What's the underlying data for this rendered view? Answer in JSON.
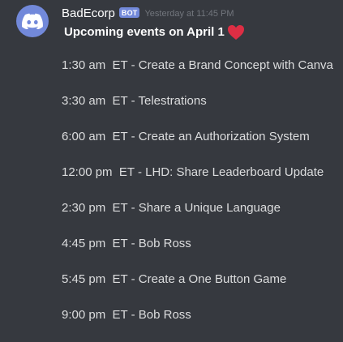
{
  "message": {
    "username": "BadEcorp",
    "bot_tag": "BOT",
    "timestamp": "Yesterday at 11:45 PM",
    "title": "Upcoming events on April 1",
    "heart_icon": "red-heart-icon",
    "avatar_icon": "discord-logo-icon",
    "avatar_color": "#7289da",
    "heart_color": "#dd2e44",
    "events": [
      "1:30 am  ET - Create a Brand Concept with Canva",
      "3:30 am  ET - Telestrations",
      "6:00 am  ET - Create an Authorization System",
      "12:00 pm  ET - LHD: Share Leaderboard Update",
      "2:30 pm  ET - Share a Unique Language",
      "4:45 pm  ET - Bob Ross",
      "5:45 pm  ET - Create a One Button Game",
      "9:00 pm  ET - Bob Ross"
    ]
  }
}
